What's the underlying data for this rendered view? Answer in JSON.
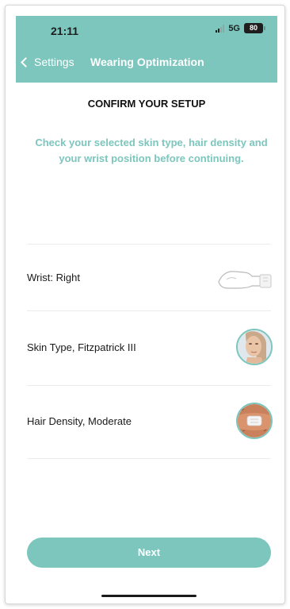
{
  "status_bar": {
    "time": "21:11",
    "network": "5G",
    "battery": "80"
  },
  "nav": {
    "back_label": "Settings",
    "title": "Wearing Optimization"
  },
  "heading": "CONFIRM YOUR SETUP",
  "instructions": "Check your selected skin type, hair density and your wrist position before continuing.",
  "rows": [
    {
      "label": "Wrist: Right",
      "icon": "wrist-icon"
    },
    {
      "label": "Skin Type, Fitzpatrick III",
      "icon": "skin-type-icon"
    },
    {
      "label": "Hair Density, Moderate",
      "icon": "hair-density-icon"
    }
  ],
  "next_button": "Next",
  "colors": {
    "accent": "#7cc6bd",
    "text": "#1a1a1a",
    "divider": "#ececec"
  }
}
